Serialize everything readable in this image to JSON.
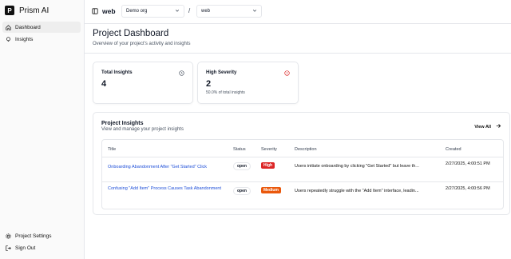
{
  "app": {
    "name": "Prism AI",
    "logo_letter": "P"
  },
  "sidebar": {
    "items": [
      {
        "label": "Dashboard",
        "icon": "home-icon",
        "active": true
      },
      {
        "label": "Insights",
        "icon": "lightbulb-icon",
        "active": false
      }
    ],
    "bottom": [
      {
        "label": "Project Settings",
        "icon": "gear-icon"
      },
      {
        "label": "Sign Out",
        "icon": "sign-out-icon"
      }
    ]
  },
  "topbar": {
    "project_code": "web",
    "org_select": "Demo org",
    "separator": "/",
    "project_select": "web"
  },
  "page": {
    "title": "Project Dashboard",
    "subtitle": "Overview of your project's activity and insights"
  },
  "stats": {
    "total": {
      "label": "Total Insights",
      "value": "4"
    },
    "high": {
      "label": "High Severity",
      "value": "2",
      "note": "50.0% of total insights"
    }
  },
  "insights": {
    "title": "Project Insights",
    "subtitle": "View and manage your project insights",
    "view_all": "View All",
    "columns": [
      "Title",
      "Status",
      "Severity",
      "Description",
      "Created"
    ],
    "rows": [
      {
        "title": "Onboarding Abandonment After \"Get Started\" Click",
        "status": "open",
        "severity": "High",
        "severity_color": "#dc2626",
        "description": "Users initiate onboarding by clicking \"Get Started\" but leave th...",
        "created": "2/27/2025, 4:00:51 PM"
      },
      {
        "title": "Confusing \"Add Item\" Process Causes Task Abandonment",
        "status": "open",
        "severity": "Medium",
        "severity_color": "#ea580c",
        "description": "Users repeatedly struggle with the \"Add Item\" interface, leadin...",
        "created": "2/27/2025, 4:00:56 PM"
      }
    ]
  }
}
